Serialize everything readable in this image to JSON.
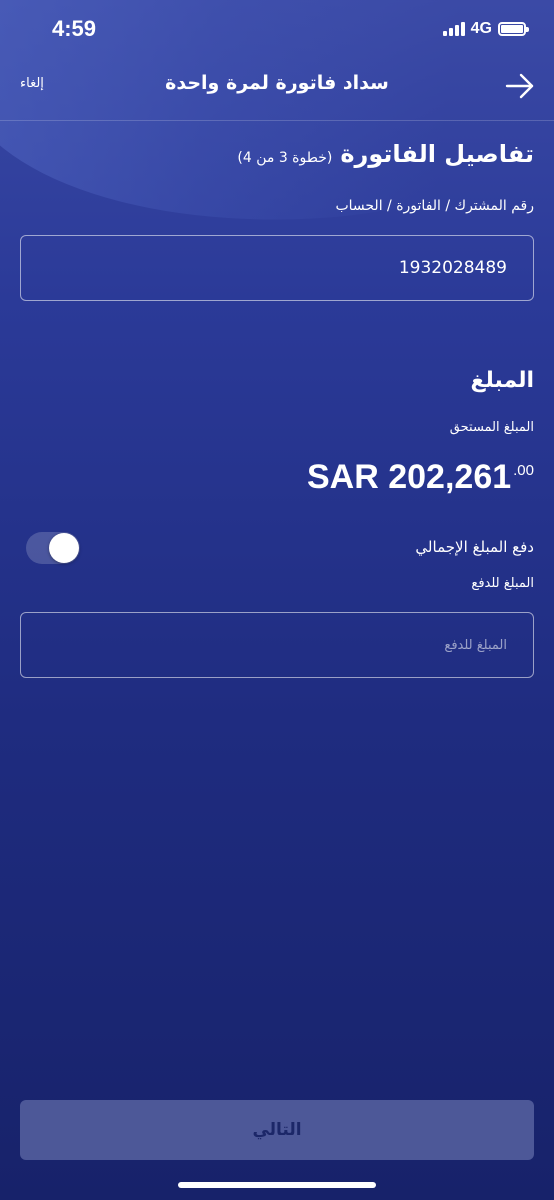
{
  "status_bar": {
    "time": "4:59",
    "network": "4G"
  },
  "nav": {
    "cancel_label": "إلغاء",
    "title": "سداد فاتورة لمرة واحدة",
    "back_icon": "arrow-right-icon"
  },
  "bill_details": {
    "title": "تفاصيل الفاتورة",
    "step": "(خطوة 3 من 4)",
    "account_label": "رقم المشترك / الفاتورة / الحساب",
    "account_value": "1932028489"
  },
  "amount": {
    "title": "المبلغ",
    "due_label": "المبلغ المستحق",
    "due_value_main": "SAR 202,261",
    "due_value_cents": ".00",
    "pay_full_label": "دفع المبلغ الإجمالي",
    "pay_full_enabled": true,
    "pay_amount_label": "المبلغ للدفع",
    "pay_amount_placeholder": "المبلغ للدفع"
  },
  "footer": {
    "next_label": "التالي"
  },
  "colors": {
    "background_top": "#3b4aa6",
    "background_bottom": "#17226a",
    "button_bg": "#4d5898",
    "button_text": "#1c2768"
  }
}
